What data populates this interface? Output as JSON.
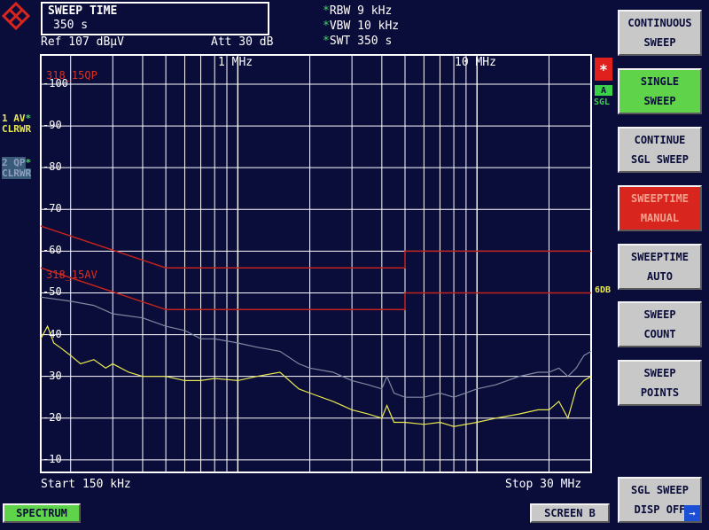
{
  "status": {
    "sweep_title": "SWEEP TIME",
    "sweep_value": "350 s",
    "ref": "Ref  107 dBµV",
    "att": "Att  30 dB"
  },
  "settings": [
    {
      "star": "*",
      "text": "RBW 9 kHz"
    },
    {
      "star": "*",
      "text": "VBW 10 kHz"
    },
    {
      "star": "*",
      "text": "SWT 350 s"
    }
  ],
  "traces_labels": {
    "t1_line1": "1 AV",
    "t1_line2": "CLRWR",
    "t2_line1": "2 QP",
    "t2_line2": "CLRWR",
    "t1_color": "#e8e850",
    "t2_color": "#7f8aa0"
  },
  "axis": {
    "x_marker_1": "1 MHz",
    "x_marker_2": "10 MHz",
    "start": "Start 150 kHz",
    "stop": "Stop 30 MHz",
    "y_ticks": [
      "100",
      "90",
      "80",
      "70",
      "60",
      "50",
      "40",
      "30",
      "20",
      "10"
    ]
  },
  "limits": {
    "qp_label": "318_15QP",
    "av_label": "318_15AV",
    "color": "#c0241c"
  },
  "indicators": {
    "alert": "*",
    "a": "A",
    "sgl": "SGL",
    "sixdb": "6DB"
  },
  "softkeys": [
    {
      "line1": "CONTINUOUS",
      "line2": "SWEEP",
      "state": "normal"
    },
    {
      "line1": "SINGLE",
      "line2": "SWEEP",
      "state": "active"
    },
    {
      "line1": "CONTINUE",
      "line2": "SGL SWEEP",
      "state": "normal"
    },
    {
      "line1": "SWEEPTIME",
      "line2": "MANUAL",
      "state": "selected"
    },
    {
      "line1": "SWEEPTIME",
      "line2": "AUTO",
      "state": "normal"
    },
    {
      "line1": "SWEEP",
      "line2": "COUNT",
      "state": "normal"
    },
    {
      "line1": "SWEEP",
      "line2": "POINTS",
      "state": "normal"
    },
    {
      "line1": "SGL SWEEP",
      "line2": "DISP OFF",
      "state": "normal"
    }
  ],
  "bottom": {
    "spectrum": "SPECTRUM",
    "screen_b": "SCREEN B"
  },
  "chart_data": {
    "type": "line",
    "x_scale": "log",
    "xlim_mhz": [
      0.15,
      30
    ],
    "ylim_dbuv": [
      7,
      107
    ],
    "grid": true,
    "series": [
      {
        "name": "1 AV",
        "color": "#e8e850",
        "x_mhz": [
          0.15,
          0.16,
          0.17,
          0.18,
          0.2,
          0.22,
          0.25,
          0.28,
          0.3,
          0.35,
          0.4,
          0.5,
          0.6,
          0.7,
          0.8,
          1.0,
          1.2,
          1.5,
          1.8,
          2.0,
          2.5,
          3.0,
          3.5,
          4.0,
          4.2,
          4.5,
          5.0,
          6.0,
          7.0,
          8.0,
          10.0,
          12.0,
          15.0,
          18.0,
          20.0,
          22.0,
          24.0,
          26.0,
          28.0,
          30.0
        ],
        "y_dbuv": [
          39,
          42,
          38,
          37,
          35,
          33,
          34,
          32,
          33,
          31,
          30,
          30,
          29,
          29,
          29.5,
          29,
          30,
          31,
          27,
          26,
          24,
          22,
          21,
          20,
          23,
          19,
          19,
          18.5,
          19,
          18,
          19,
          20,
          21,
          22,
          22,
          24,
          20,
          27,
          29,
          30
        ]
      },
      {
        "name": "2 QP",
        "color": "#7f8aa0",
        "x_mhz": [
          0.15,
          0.2,
          0.25,
          0.3,
          0.4,
          0.5,
          0.6,
          0.7,
          0.8,
          1.0,
          1.2,
          1.5,
          1.8,
          2.0,
          2.5,
          3.0,
          3.5,
          4.0,
          4.2,
          4.5,
          5.0,
          6.0,
          7.0,
          8.0,
          10.0,
          12.0,
          15.0,
          18.0,
          20.0,
          22.0,
          24.0,
          26.0,
          28.0,
          30.0
        ],
        "y_dbuv": [
          49,
          48,
          47,
          45,
          44,
          42,
          41,
          39,
          39,
          38,
          37,
          36,
          33,
          32,
          31,
          29,
          28,
          27,
          30,
          26,
          25,
          25,
          26,
          25,
          27,
          28,
          30,
          31,
          31,
          32,
          30,
          32,
          35,
          36
        ]
      }
    ],
    "limit_lines": [
      {
        "name": "318_15QP",
        "color": "#c0241c",
        "x_mhz": [
          0.15,
          0.5,
          5.0,
          5.0,
          30.0
        ],
        "y_dbuv": [
          66,
          56,
          56,
          60,
          60
        ]
      },
      {
        "name": "318_15AV",
        "color": "#c0241c",
        "x_mhz": [
          0.15,
          0.5,
          5.0,
          5.0,
          30.0
        ],
        "y_dbuv": [
          56,
          46,
          46,
          50,
          50
        ]
      }
    ]
  }
}
